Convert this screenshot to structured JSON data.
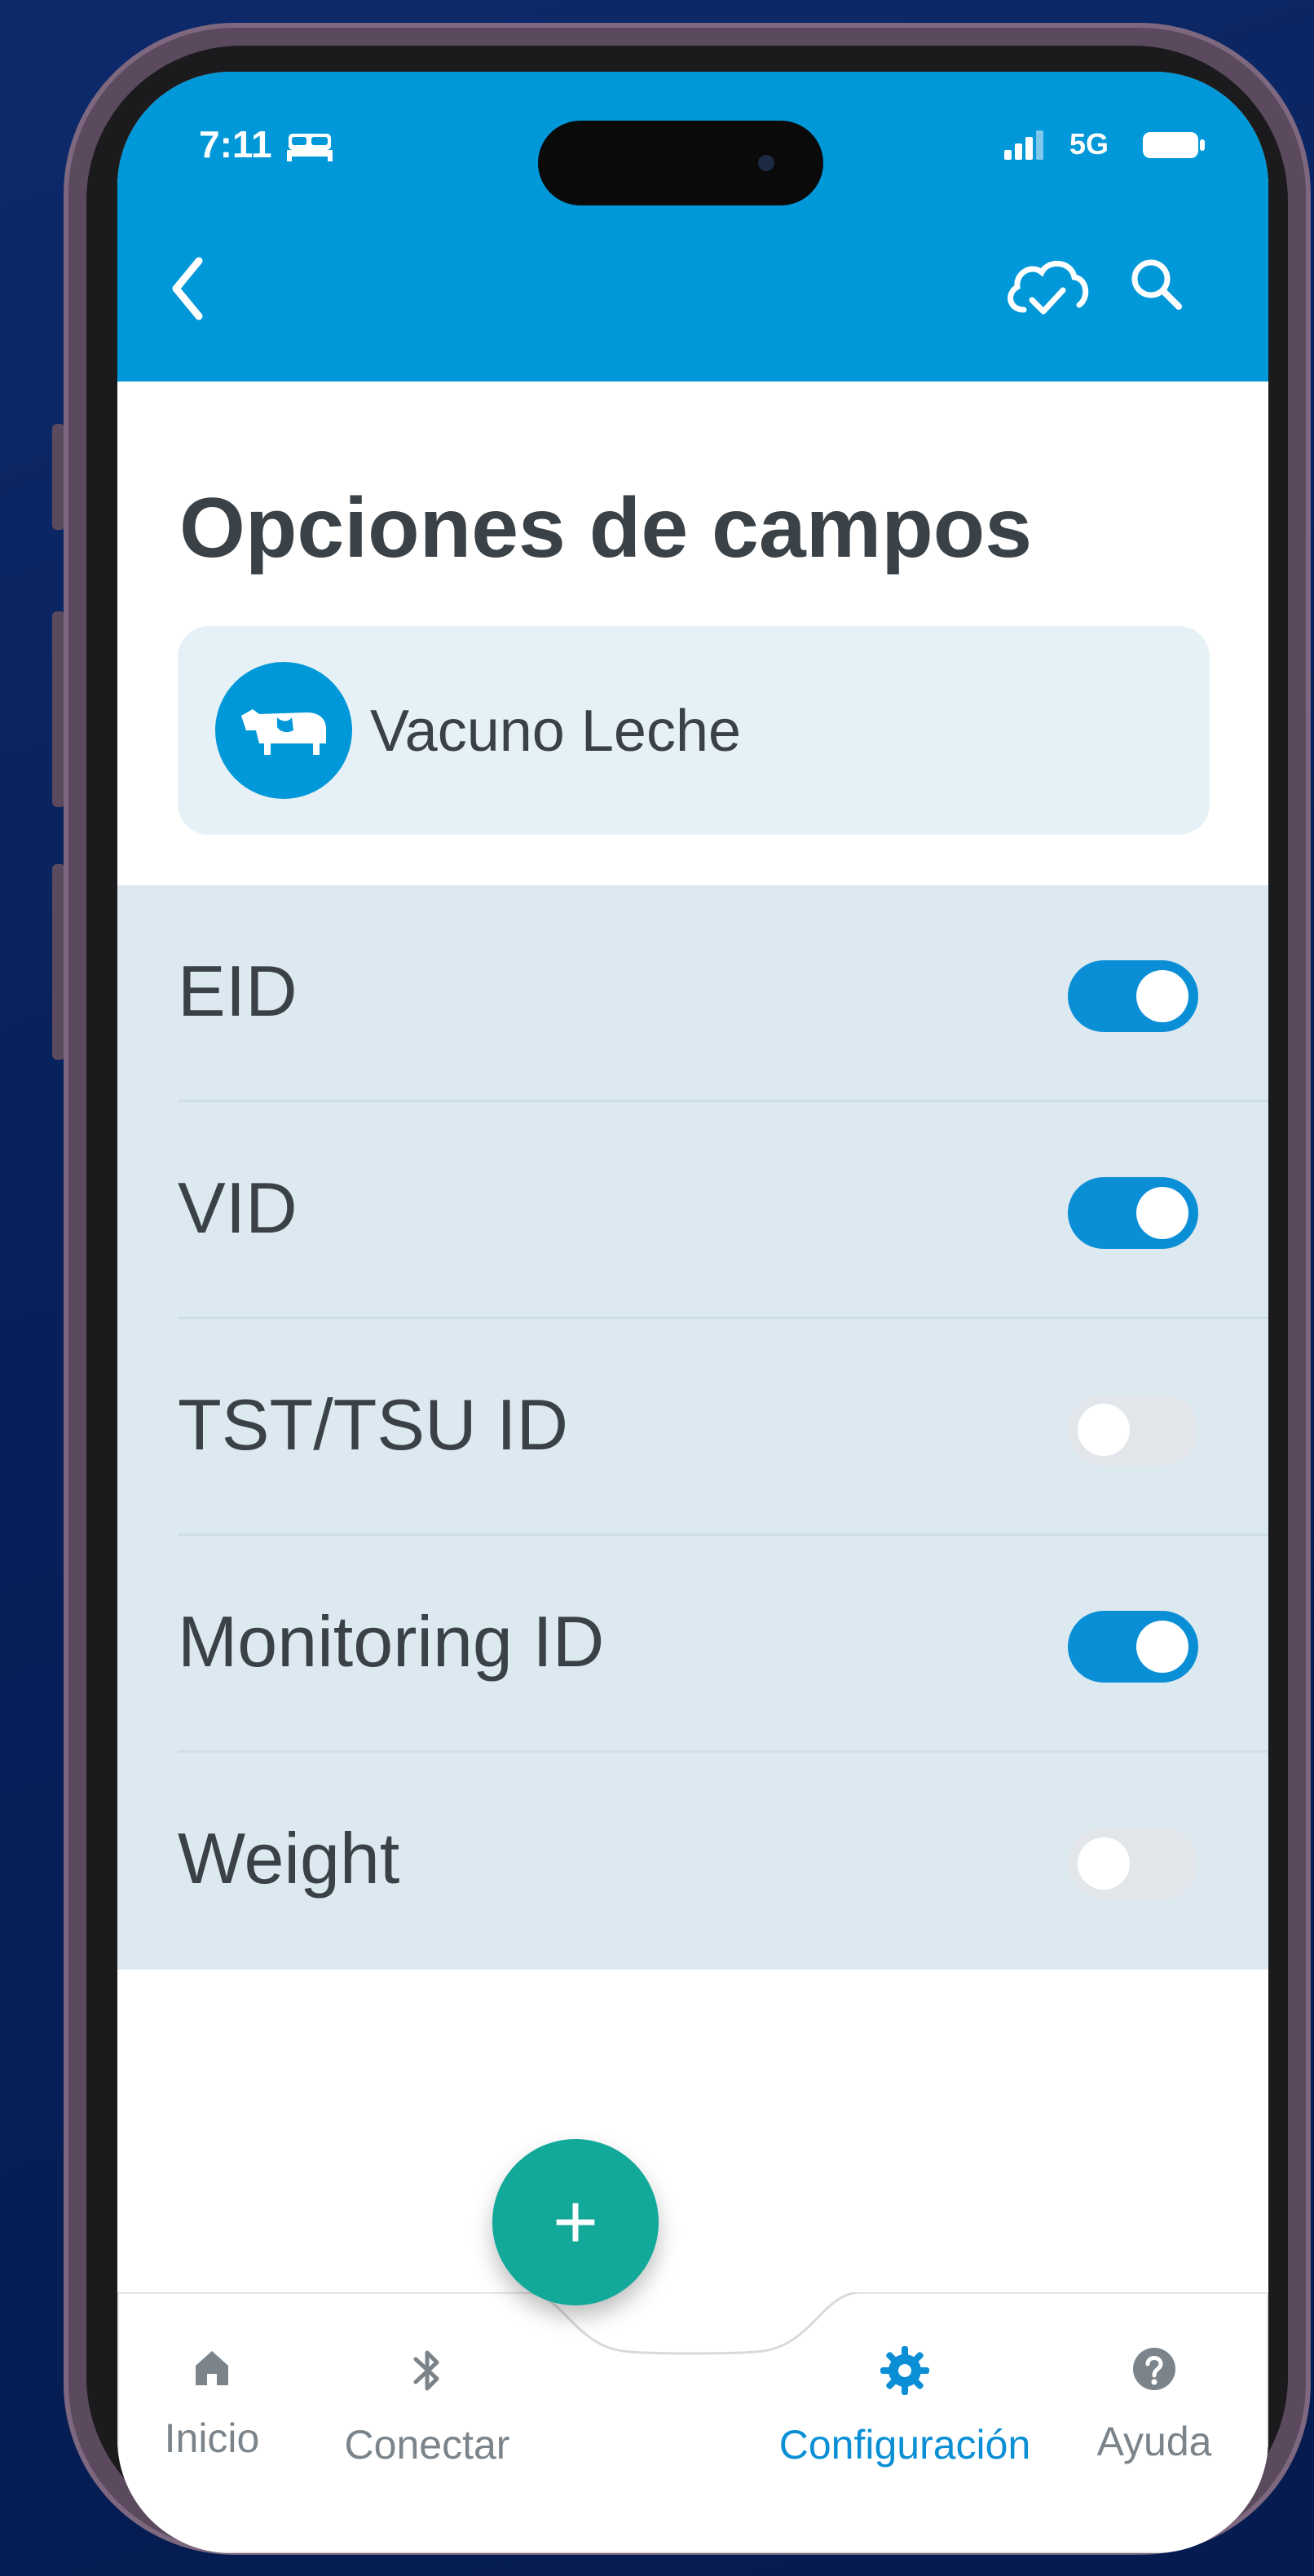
{
  "status": {
    "time": "7:11",
    "network": "5G",
    "icons": [
      "bed-icon",
      "signal-icon",
      "battery-icon"
    ]
  },
  "appbar": {
    "icons": [
      "back-chevron-icon",
      "cloud-sync-icon",
      "search-icon"
    ],
    "background": "#0098d8"
  },
  "page": {
    "title": "Opciones de campos"
  },
  "species": {
    "icon": "cow-icon",
    "label": "Vacuno Leche"
  },
  "options": [
    {
      "label": "EID",
      "enabled": true
    },
    {
      "label": "VID",
      "enabled": true
    },
    {
      "label": "TST/TSU ID",
      "enabled": false
    },
    {
      "label": "Monitoring ID",
      "enabled": true
    },
    {
      "label": "Weight",
      "enabled": false
    }
  ],
  "fab": {
    "symbol": "+",
    "color": "#12a89a"
  },
  "nav": {
    "items": [
      {
        "label": "Inicio",
        "icon": "home-icon",
        "active": false
      },
      {
        "label": "Conectar",
        "icon": "bluetooth-icon",
        "active": false
      },
      {
        "label": "Configuración",
        "icon": "gear-icon",
        "active": true
      },
      {
        "label": "Ayuda",
        "icon": "help-icon",
        "active": false
      }
    ],
    "active_color": "#0a8fd6"
  }
}
